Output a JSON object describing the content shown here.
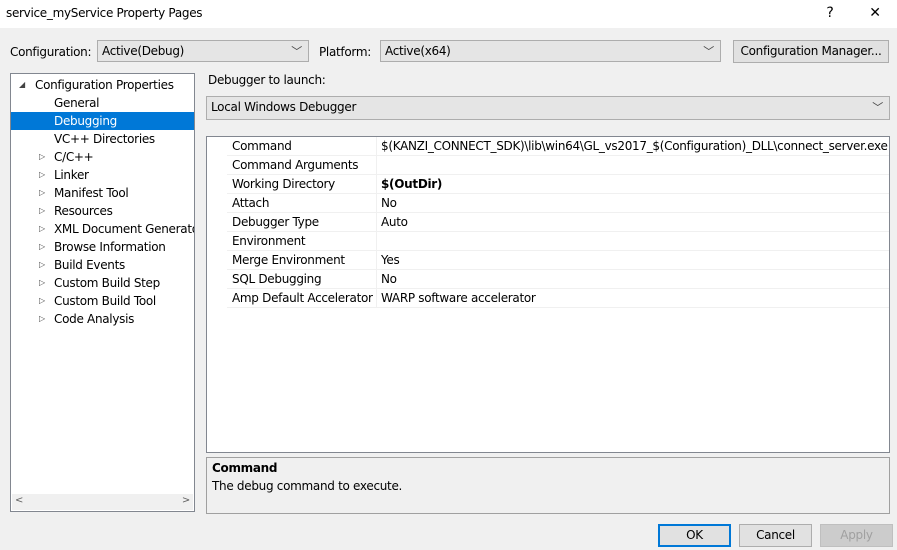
{
  "window": {
    "title": "service_myService Property Pages",
    "help": "?",
    "close": "✕"
  },
  "config": {
    "label": "Configuration:",
    "value": "Active(Debug)",
    "platform_label": "Platform:",
    "platform_value": "Active(x64)",
    "manager_button": "Configuration Manager..."
  },
  "tree": {
    "root": "Configuration Properties",
    "items": [
      "General",
      "Debugging",
      "VC++ Directories",
      "C/C++",
      "Linker",
      "Manifest Tool",
      "Resources",
      "XML Document Generator",
      "Browse Information",
      "Build Events",
      "Custom Build Step",
      "Custom Build Tool",
      "Code Analysis"
    ],
    "selected": "Debugging"
  },
  "debugger": {
    "label": "Debugger to launch:",
    "value": "Local Windows Debugger"
  },
  "properties": [
    {
      "name": "Command",
      "value": "$(KANZI_CONNECT_SDK)\\lib\\win64\\GL_vs2017_$(Configuration)_DLL\\connect_server.exe"
    },
    {
      "name": "Command Arguments",
      "value": ""
    },
    {
      "name": "Working Directory",
      "value": "$(OutDir)",
      "bold": true
    },
    {
      "name": "Attach",
      "value": "No"
    },
    {
      "name": "Debugger Type",
      "value": "Auto"
    },
    {
      "name": "Environment",
      "value": ""
    },
    {
      "name": "Merge Environment",
      "value": "Yes"
    },
    {
      "name": "SQL Debugging",
      "value": "No"
    },
    {
      "name": "Amp Default Accelerator",
      "value": "WARP software accelerator"
    }
  ],
  "description": {
    "title": "Command",
    "text": "The debug command to execute."
  },
  "buttons": {
    "ok": "OK",
    "cancel": "Cancel",
    "apply": "Apply"
  }
}
